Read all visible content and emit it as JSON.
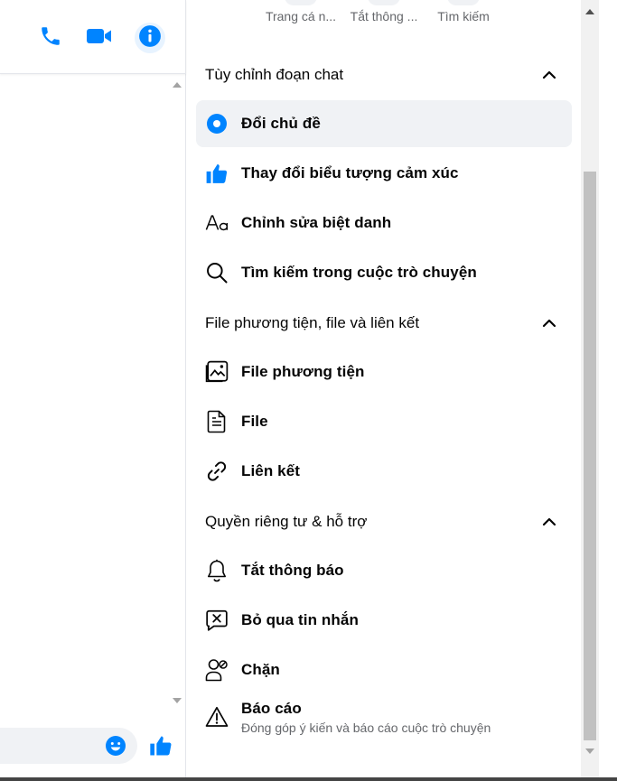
{
  "chat": {
    "header_buttons": [
      {
        "name": "phone-icon"
      },
      {
        "name": "video-camera-icon"
      },
      {
        "name": "info-icon"
      }
    ]
  },
  "quick_actions": [
    {
      "label": "Trang cá n..."
    },
    {
      "label": "Tắt thông ..."
    },
    {
      "label": "Tìm kiếm"
    }
  ],
  "sections": {
    "customize": {
      "title": "Tùy chỉnh đoạn chat",
      "items": [
        {
          "label": "Đổi chủ đề",
          "icon": "theme-circle-icon"
        },
        {
          "label": "Thay đổi biểu tượng cảm xúc",
          "icon": "thumbs-up-icon"
        },
        {
          "label": "Chỉnh sửa biệt danh",
          "icon": "text-aa-icon"
        },
        {
          "label": "Tìm kiếm trong cuộc trò chuyện",
          "icon": "search-icon"
        }
      ]
    },
    "media": {
      "title": "File phương tiện, file và liên kết",
      "items": [
        {
          "label": "File phương tiện",
          "icon": "photo-gallery-icon"
        },
        {
          "label": "File",
          "icon": "file-icon"
        },
        {
          "label": "Liên kết",
          "icon": "link-icon"
        }
      ]
    },
    "privacy": {
      "title": "Quyền riêng tư & hỗ trợ",
      "items": [
        {
          "label": "Tắt thông báo",
          "icon": "bell-icon"
        },
        {
          "label": "Bỏ qua tin nhắn",
          "icon": "ignore-message-icon"
        },
        {
          "label": "Chặn",
          "icon": "block-user-icon"
        },
        {
          "label": "Báo cáo",
          "sublabel": "Đóng góp ý kiến và báo cáo cuộc trò chuyện",
          "icon": "warning-icon"
        }
      ]
    }
  },
  "colors": {
    "accent": "#0084ff",
    "text_primary": "#050505",
    "text_secondary": "#65676b",
    "active_bg": "#f0f2f5"
  }
}
